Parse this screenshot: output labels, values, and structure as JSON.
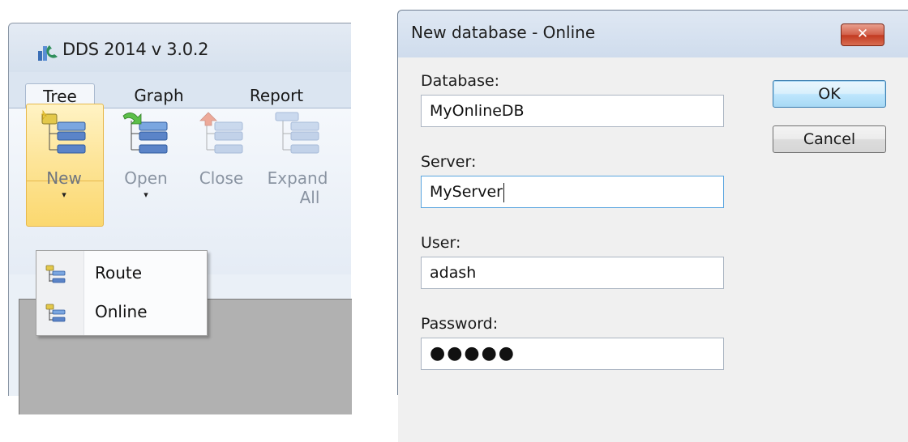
{
  "app": {
    "title": "DDS 2014 v 3.0.2",
    "tabs": [
      {
        "label": "Tree",
        "active": true
      },
      {
        "label": "Graph",
        "active": false
      },
      {
        "label": "Report",
        "active": false
      }
    ],
    "ribbon": {
      "new": {
        "label": "New",
        "arrow": "▾",
        "icon": "tree-new-icon"
      },
      "open": {
        "label": "Open",
        "arrow": "▾",
        "icon": "tree-open-icon"
      },
      "close": {
        "label": "Close",
        "icon": "tree-close-icon"
      },
      "expand": {
        "label_line1": "Expand",
        "label_line2": "All",
        "icon": "tree-expand-icon"
      }
    },
    "menu": {
      "items": [
        {
          "label": "Route",
          "icon": "tree-new-icon"
        },
        {
          "label": "Online",
          "icon": "tree-new-icon"
        }
      ]
    }
  },
  "dialog": {
    "title": "New database - Online",
    "close_glyph": "✕",
    "fields": {
      "database": {
        "label": "Database:",
        "value": "MyOnlineDB"
      },
      "server": {
        "label": "Server:",
        "value": "MyServer"
      },
      "user": {
        "label": "User:",
        "value": "adash"
      },
      "password": {
        "label": "Password:",
        "value": "●●●●●"
      }
    },
    "buttons": {
      "ok": "OK",
      "cancel": "Cancel"
    }
  },
  "colors": {
    "accent_hot": "#fbd86f",
    "close_red": "#c23a20",
    "focus_blue": "#5aa5e0",
    "node_blue": "#5b84c8"
  }
}
